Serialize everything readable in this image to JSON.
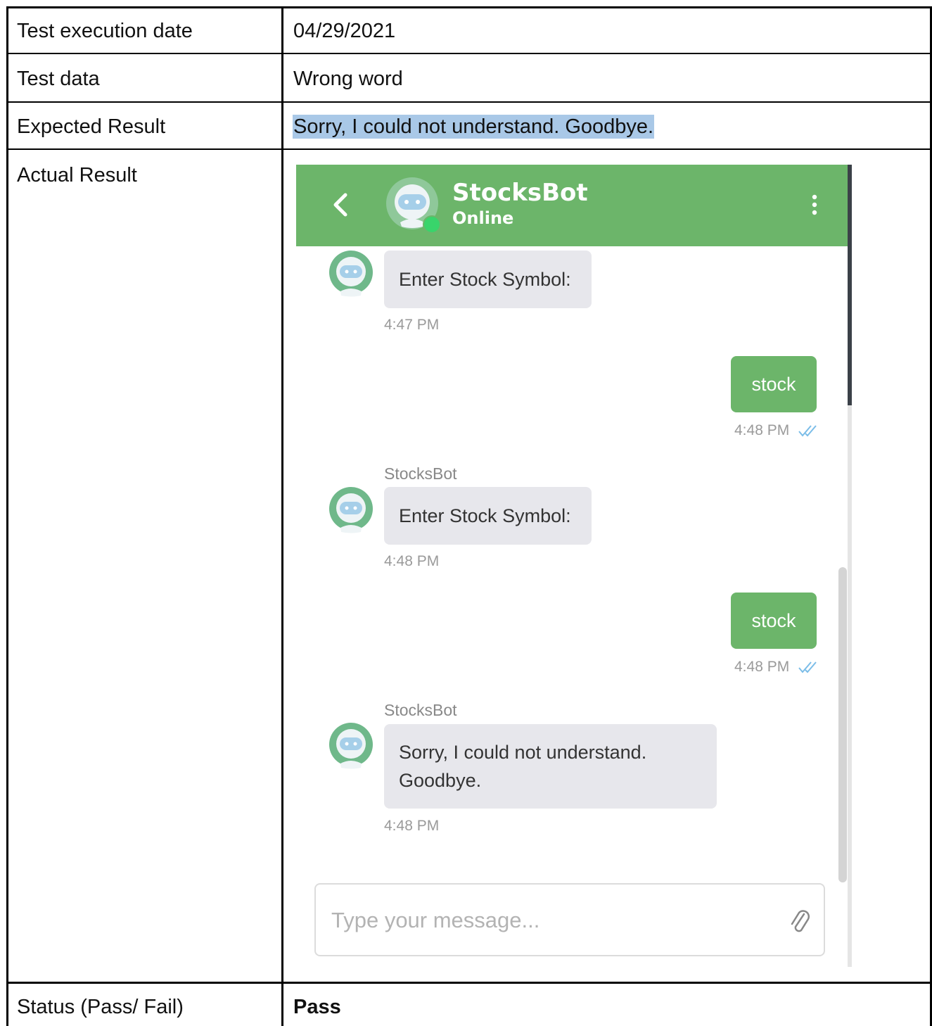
{
  "table": {
    "rows": [
      {
        "label": "Test execution date",
        "value": "04/29/2021"
      },
      {
        "label": "Test data",
        "value": "Wrong word"
      },
      {
        "label": "Expected Result",
        "value": "Sorry, I could not understand. Goodbye."
      },
      {
        "label": "Actual Result"
      },
      {
        "label": "Status (Pass/ Fail)",
        "value": "Pass"
      }
    ]
  },
  "chat": {
    "header": {
      "bot_name": "StocksBot",
      "status": "Online"
    },
    "messages": [
      {
        "from": "bot",
        "sender": "",
        "text": "Enter Stock Symbol:",
        "time": "4:47 PM"
      },
      {
        "from": "user",
        "text": "stock",
        "time": "4:48 PM"
      },
      {
        "from": "bot",
        "sender": "StocksBot",
        "text": "Enter Stock Symbol:",
        "time": "4:48 PM"
      },
      {
        "from": "user",
        "text": "stock",
        "time": "4:48 PM"
      },
      {
        "from": "bot",
        "sender": "StocksBot",
        "text_line1": "Sorry, I could not understand.",
        "text_line2": "Goodbye.",
        "time": "4:48 PM"
      }
    ],
    "input": {
      "placeholder": "Type your message..."
    },
    "icons": {
      "back": "chevron-left-icon",
      "menu": "kebab-menu-icon",
      "attach": "paperclip-icon",
      "read": "double-check-icon",
      "avatar": "robot-icon"
    },
    "colors": {
      "header": "#6cb56a",
      "online": "#39d46b",
      "bot_bubble": "#e7e7ec",
      "user_bubble": "#6cb56a",
      "highlight": "#a9c8e7"
    }
  }
}
